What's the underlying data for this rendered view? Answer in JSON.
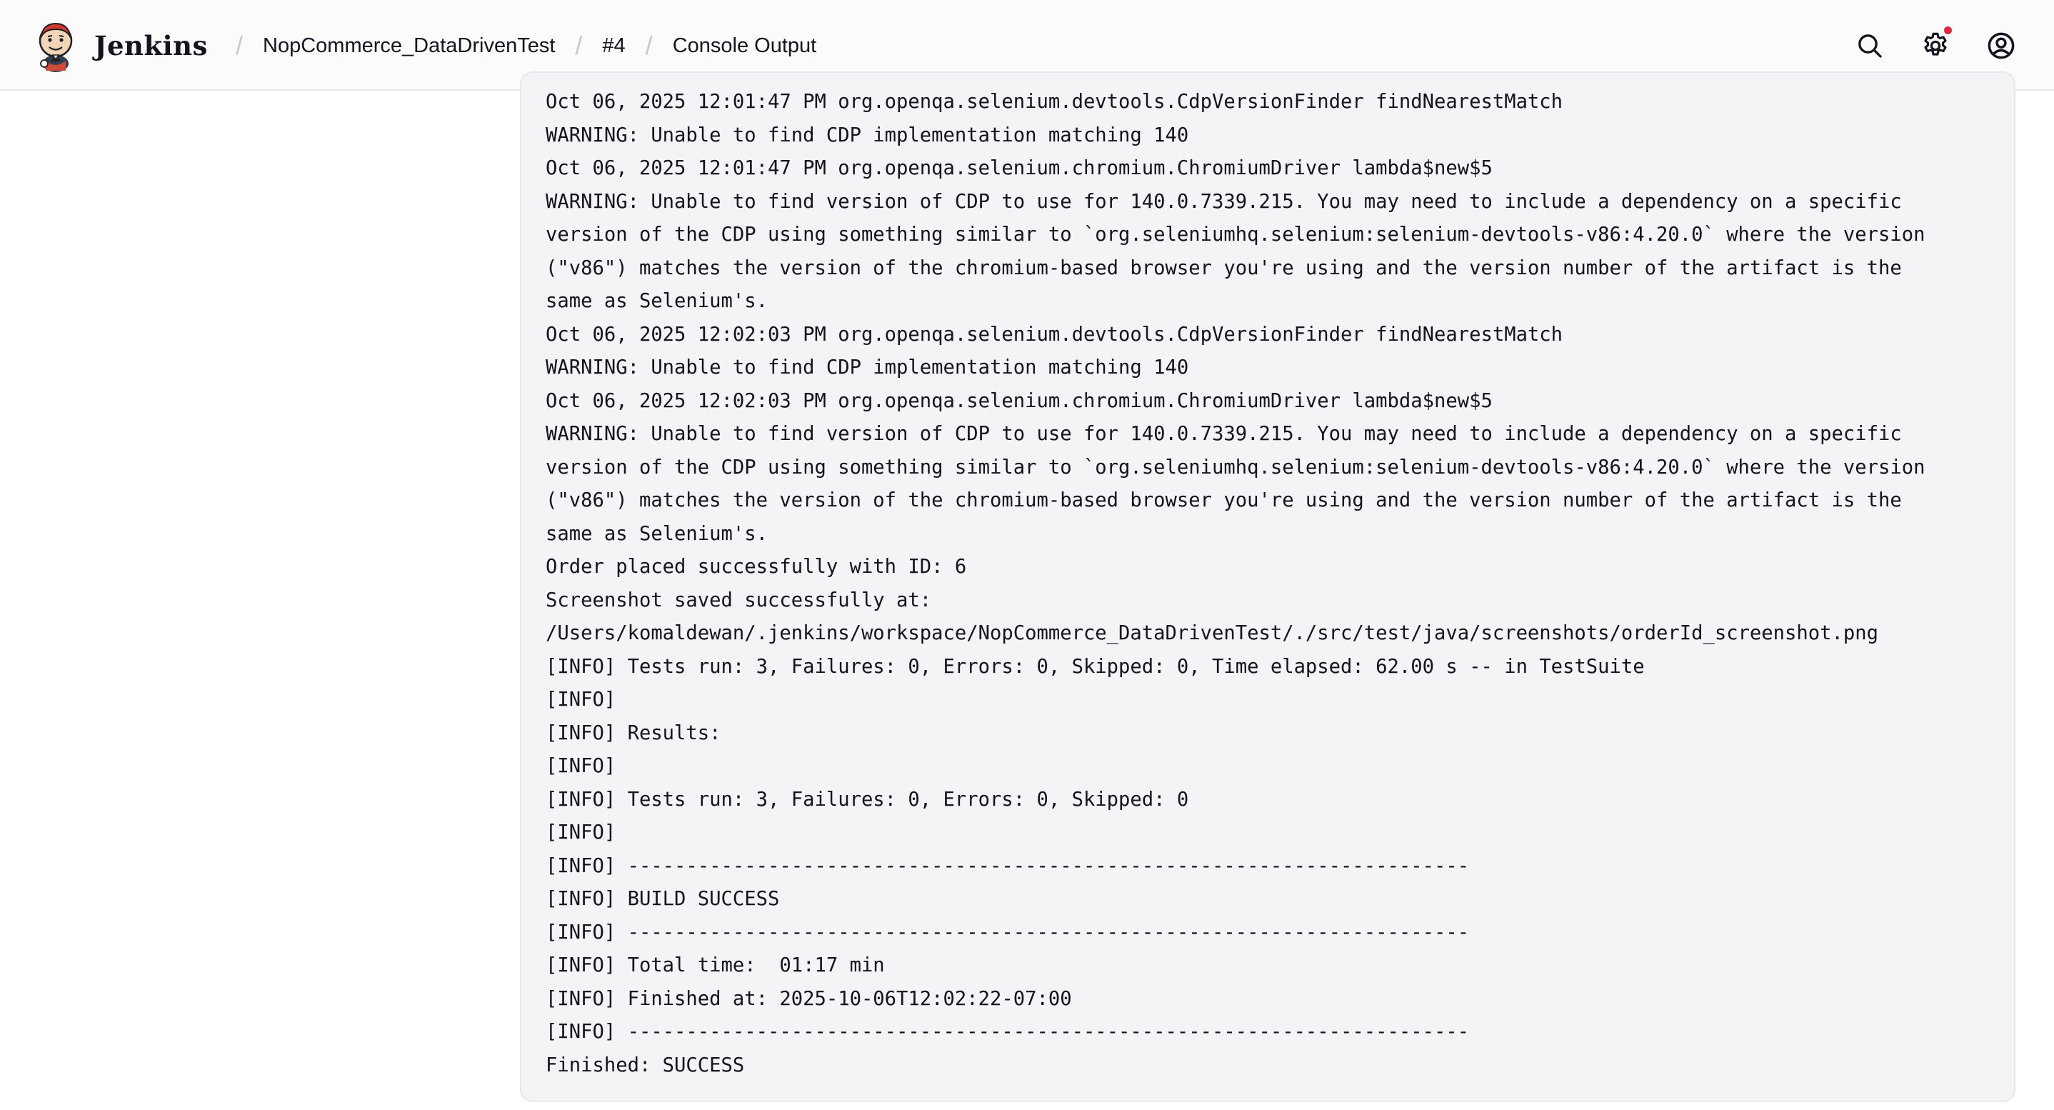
{
  "header": {
    "app_name": "Jenkins",
    "breadcrumbs": [
      {
        "label": "NopCommerce_DataDrivenTest"
      },
      {
        "label": "#4"
      },
      {
        "label": "Console Output"
      }
    ],
    "separator": "/",
    "actions": [
      {
        "name": "search-icon",
        "label": "Search"
      },
      {
        "name": "gear-icon",
        "label": "Manage Jenkins",
        "notification": true
      },
      {
        "name": "user-icon",
        "label": "User"
      }
    ]
  },
  "console": {
    "lines": [
      "Oct 06, 2025 12:01:47 PM org.openqa.selenium.devtools.CdpVersionFinder findNearestMatch",
      "WARNING: Unable to find CDP implementation matching 140",
      "Oct 06, 2025 12:01:47 PM org.openqa.selenium.chromium.ChromiumDriver lambda$new$5",
      "WARNING: Unable to find version of CDP to use for 140.0.7339.215. You may need to include a dependency on a specific",
      "version of the CDP using something similar to `org.seleniumhq.selenium:selenium-devtools-v86:4.20.0` where the version",
      "(\"v86\") matches the version of the chromium-based browser you're using and the version number of the artifact is the",
      "same as Selenium's.",
      "Oct 06, 2025 12:02:03 PM org.openqa.selenium.devtools.CdpVersionFinder findNearestMatch",
      "WARNING: Unable to find CDP implementation matching 140",
      "Oct 06, 2025 12:02:03 PM org.openqa.selenium.chromium.ChromiumDriver lambda$new$5",
      "WARNING: Unable to find version of CDP to use for 140.0.7339.215. You may need to include a dependency on a specific",
      "version of the CDP using something similar to `org.seleniumhq.selenium:selenium-devtools-v86:4.20.0` where the version",
      "(\"v86\") matches the version of the chromium-based browser you're using and the version number of the artifact is the",
      "same as Selenium's.",
      "Order placed successfully with ID: 6",
      "Screenshot saved successfully at:",
      "/Users/komaldewan/.jenkins/workspace/NopCommerce_DataDrivenTest/./src/test/java/screenshots/orderId_screenshot.png",
      "[INFO] Tests run: 3, Failures: 0, Errors: 0, Skipped: 0, Time elapsed: 62.00 s -- in TestSuite",
      "[INFO]",
      "[INFO] Results:",
      "[INFO]",
      "[INFO] Tests run: 3, Failures: 0, Errors: 0, Skipped: 0",
      "[INFO]",
      "[INFO] ------------------------------------------------------------------------",
      "[INFO] BUILD SUCCESS",
      "[INFO] ------------------------------------------------------------------------",
      "[INFO] Total time:  01:17 min",
      "[INFO] Finished at: 2025-10-06T12:02:22-07:00",
      "[INFO] ------------------------------------------------------------------------",
      "Finished: SUCCESS"
    ]
  }
}
